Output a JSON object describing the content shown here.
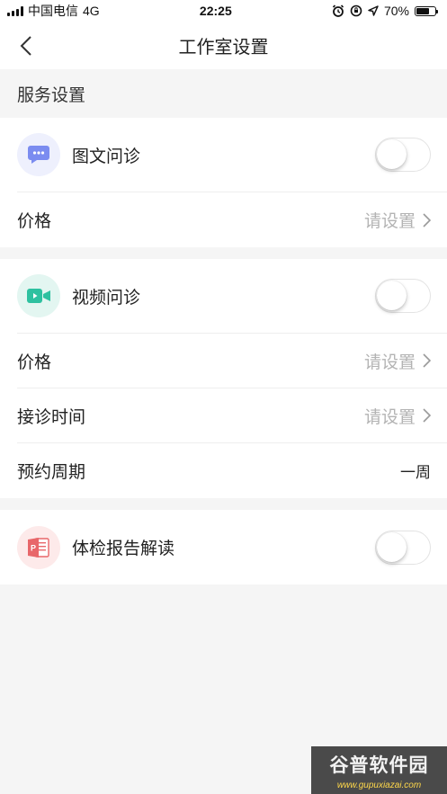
{
  "status_bar": {
    "carrier": "中国电信",
    "network": "4G",
    "time": "22:25",
    "battery": "70%",
    "battery_level": 0.7
  },
  "nav": {
    "title": "工作室设置"
  },
  "section": {
    "header": "服务设置"
  },
  "image_text": {
    "label": "图文问诊",
    "price_label": "价格",
    "price_hint": "请设置",
    "enabled": false
  },
  "video": {
    "label": "视频问诊",
    "price_label": "价格",
    "price_hint": "请设置",
    "time_label": "接诊时间",
    "time_hint": "请设置",
    "cycle_label": "预约周期",
    "cycle_value": "一周",
    "enabled": false
  },
  "report": {
    "label": "体检报告解读",
    "enabled": false
  },
  "colors": {
    "chat_icon": "#7b8cf0",
    "chat_bg": "#eef0fd",
    "video_icon": "#2ec1a0",
    "video_bg": "#e3f6f1",
    "report_icon": "#e8676a",
    "report_bg": "#fdeaea"
  },
  "watermark": {
    "line1": "谷普软件园",
    "line2": "www.gupuxiazai.com"
  }
}
